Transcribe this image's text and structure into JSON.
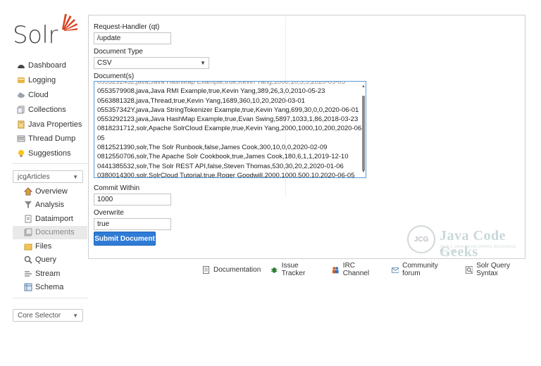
{
  "logo": {
    "text": "Solr"
  },
  "sidebar": {
    "items": [
      {
        "label": "Dashboard",
        "icon": "dashboard-icon"
      },
      {
        "label": "Logging",
        "icon": "logging-icon"
      },
      {
        "label": "Cloud",
        "icon": "cloud-icon"
      },
      {
        "label": "Collections",
        "icon": "collections-icon"
      },
      {
        "label": "Java Properties",
        "icon": "java-properties-icon"
      },
      {
        "label": "Thread Dump",
        "icon": "thread-dump-icon"
      },
      {
        "label": "Suggestions",
        "icon": "suggestions-icon"
      }
    ],
    "collection_selector": "jcgArticles",
    "core_selector": "Core Selector"
  },
  "core_menu": {
    "items": [
      {
        "label": "Overview",
        "icon": "overview-icon"
      },
      {
        "label": "Analysis",
        "icon": "analysis-icon"
      },
      {
        "label": "Dataimport",
        "icon": "dataimport-icon"
      },
      {
        "label": "Documents",
        "icon": "documents-icon",
        "active": true
      },
      {
        "label": "Files",
        "icon": "files-icon"
      },
      {
        "label": "Query",
        "icon": "query-icon"
      },
      {
        "label": "Stream",
        "icon": "stream-icon"
      },
      {
        "label": "Schema",
        "icon": "schema-icon"
      }
    ]
  },
  "form": {
    "request_handler_label": "Request-Handler (qt)",
    "request_handler_value": "/update",
    "document_type_label": "Document Type",
    "document_type_value": "CSV",
    "documents_label": "Document(s)",
    "documents_lines": [
      "0553579908,java,Java RMI Example,true,Kevin Yang,389,26,3,0,2010-05-23",
      "0563881328,java,Thread,true,Kevin Yang,1689,360,10,20,2020-03-01",
      "055357342Y,java,Java StringTokenizer Example,true,Kevin Yang,699,30,0,0,2020-06-01",
      "0553292123,java,Java HashMap Example,true,Evan Swing,5897,1033,1,86,2018-03-23",
      "0818231712,solr,Apache SolrCloud Example,true,Kevin Yang,2000,1000,10,200,2020-06-",
      "05",
      "0812521390,solr,The Solr Runbook,false,James Cook,300,10,0,0,2020-02-09",
      "0812550706,solr,The Apache Solr Cookbook,true,James Cook,180,6,1,1,2019-12-10",
      "0441385532,solr,The Solr REST API,false,Steven Thomas,530,30,20,2,2020-01-06",
      "0380014300,solr,SolrCloud Tutorial,true,Roger Goodwill,2000,1000,500,10,2020-06-05"
    ],
    "commit_within_label": "Commit Within",
    "commit_within_value": "1000",
    "overwrite_label": "Overwrite",
    "overwrite_value": "true",
    "submit_label": "Submit Document"
  },
  "watermark": {
    "title": "Java Code Geeks",
    "subtitle": "JAVA 2 JAVA DEVELOPERS RESOURCE CENTER",
    "badge": "JCG"
  },
  "footer": {
    "links": [
      {
        "label": "Documentation",
        "icon": "documentation-icon"
      },
      {
        "label": "Issue Tracker",
        "icon": "bug-icon"
      },
      {
        "label": "IRC Channel",
        "icon": "irc-icon"
      },
      {
        "label": "Community forum",
        "icon": "mail-icon"
      },
      {
        "label": "Solr Query Syntax",
        "icon": "query-syntax-icon"
      }
    ]
  },
  "colors": {
    "accent": "#2f7bd6",
    "logo_orange": "#d9411e"
  }
}
